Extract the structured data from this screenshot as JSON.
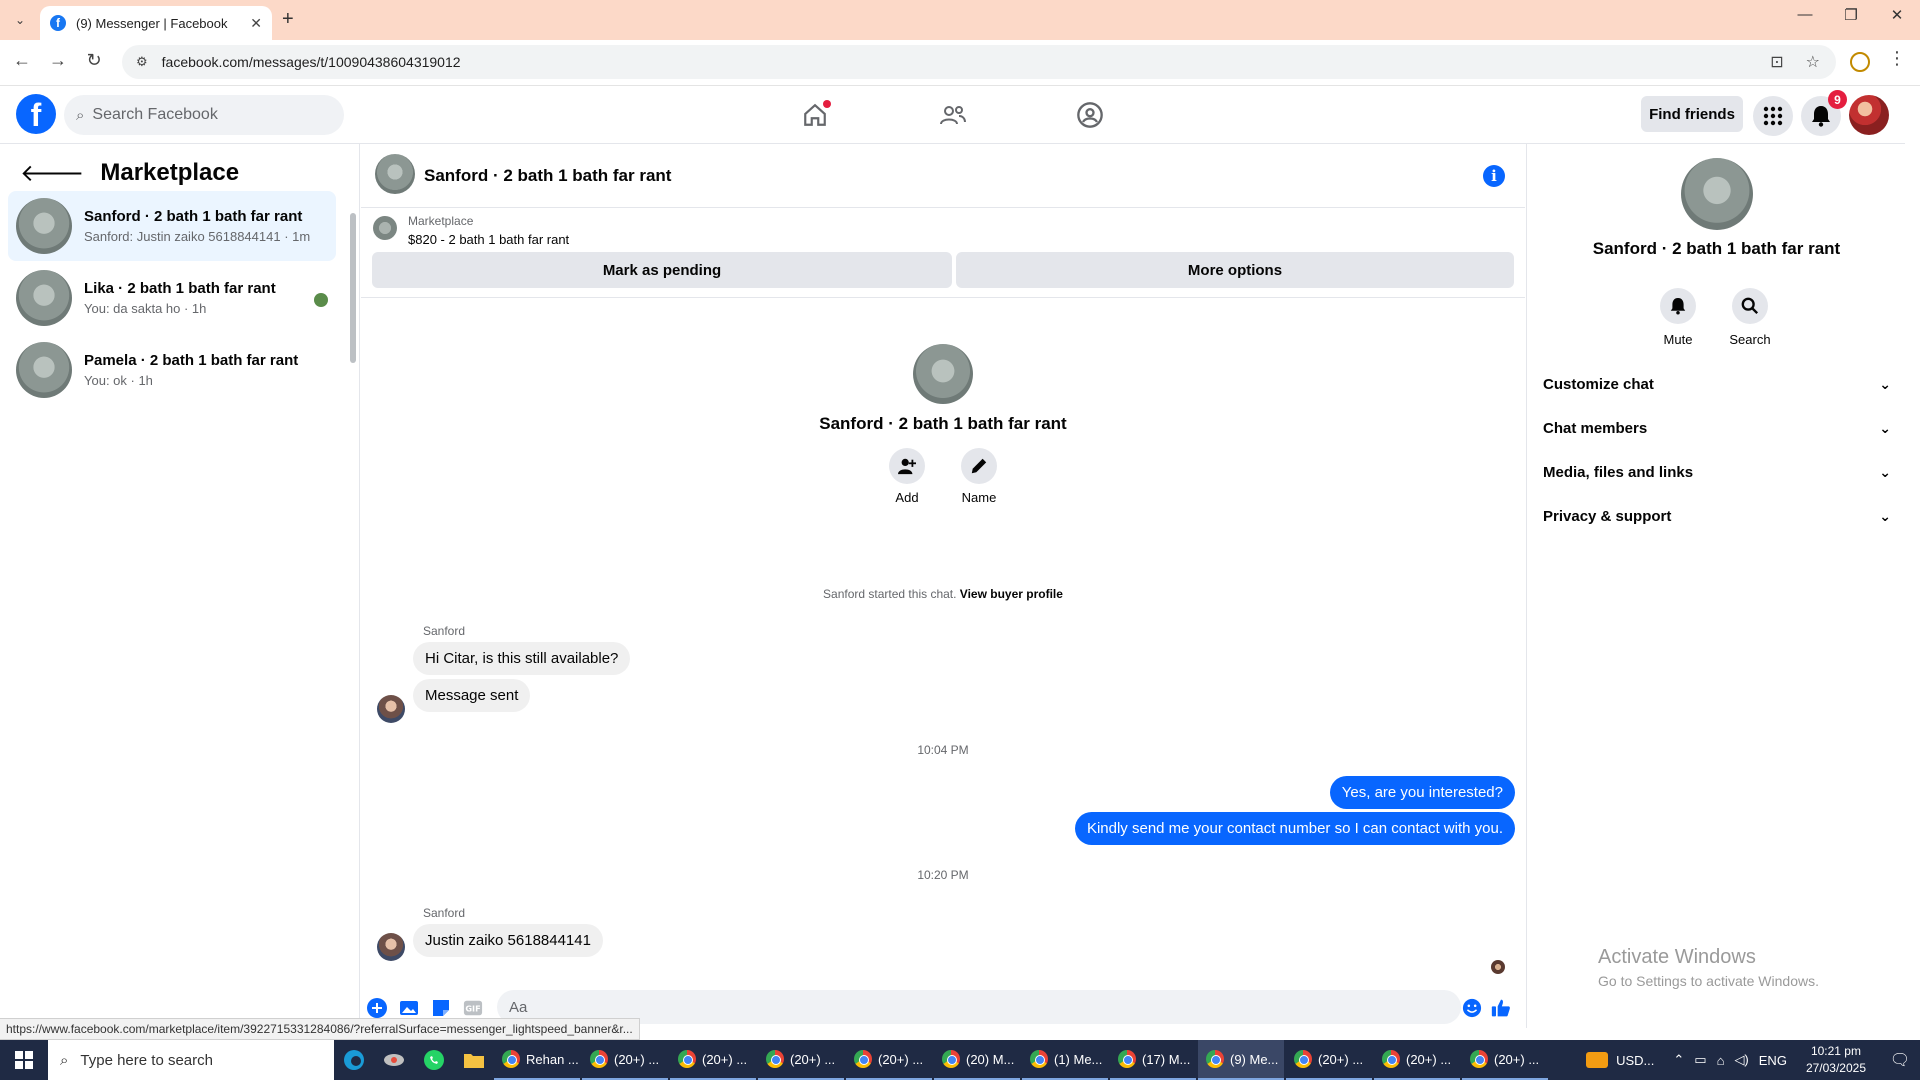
{
  "browser": {
    "tab_title": "(9) Messenger | Facebook",
    "tab_favicon": "f",
    "url": "facebook.com/messages/t/10090438604319012",
    "status_url": "https://www.facebook.com/marketplace/item/3922715331284086/?referralSurface=messenger_lightspeed_banner&r..."
  },
  "fb_header": {
    "logo": "f",
    "search_placeholder": "Search Facebook",
    "find_friends": "Find friends",
    "notification_count": "9",
    "accent": "#0866ff"
  },
  "sidebar": {
    "title": "Marketplace",
    "conversations": [
      {
        "name": "Sanford · 2 bath 1 bath far rant",
        "preview": "Sanford: Justin zaiko 5618844141 · 1m",
        "active": true
      },
      {
        "name": "Lika · 2 bath 1 bath far rant",
        "preview": "You: da sakta ho · 1h",
        "active": false
      },
      {
        "name": "Pamela · 2 bath 1 bath far rant",
        "preview": "You: ok · 1h",
        "active": false
      }
    ]
  },
  "chat": {
    "title": "Sanford · 2 bath 1 bath far rant",
    "marketplace_label": "Marketplace",
    "listing": "$820 - 2 bath 1 bath far rant",
    "mark_pending": "Mark as pending",
    "more_options": "More options",
    "profile_name": "Sanford · 2 bath 1 bath far rant",
    "add_label": "Add",
    "name_label": "Name",
    "started_text": "Sanford started this chat.",
    "view_buyer": "View buyer profile",
    "sender_1": "Sanford",
    "msg_in_1": "Hi Citar, is this still available?",
    "msg_in_2": "Message sent",
    "time_1": "10:04 PM",
    "msg_out_1": "Yes, are you interested?",
    "msg_out_2": "Kindly send me your contact number so I can contact with you.",
    "time_2": "10:20 PM",
    "sender_2": "Sanford",
    "msg_in_3": "Justin zaiko 5618844141",
    "composer_placeholder": "Aa"
  },
  "right_panel": {
    "name": "Sanford · 2 bath 1 bath far rant",
    "mute": "Mute",
    "search": "Search",
    "sections": [
      "Customize chat",
      "Chat members",
      "Media, files and links",
      "Privacy & support"
    ]
  },
  "watermark": {
    "line1": "Activate Windows",
    "line2": "Go to Settings to activate Windows."
  },
  "taskbar": {
    "search_placeholder": "Type here to search",
    "apps": [
      "Rehan ...",
      "(20+) ...",
      "(20+) ...",
      "(20+) ...",
      "(20+) ...",
      "(20) M...",
      "(1) Me...",
      "(17) M...",
      "(9) Me...",
      "(20+) ...",
      "(20+) ...",
      "(20+) ..."
    ],
    "tray_ticker": "USD...",
    "language": "ENG",
    "time": "10:21 pm",
    "date": "27/03/2025"
  }
}
